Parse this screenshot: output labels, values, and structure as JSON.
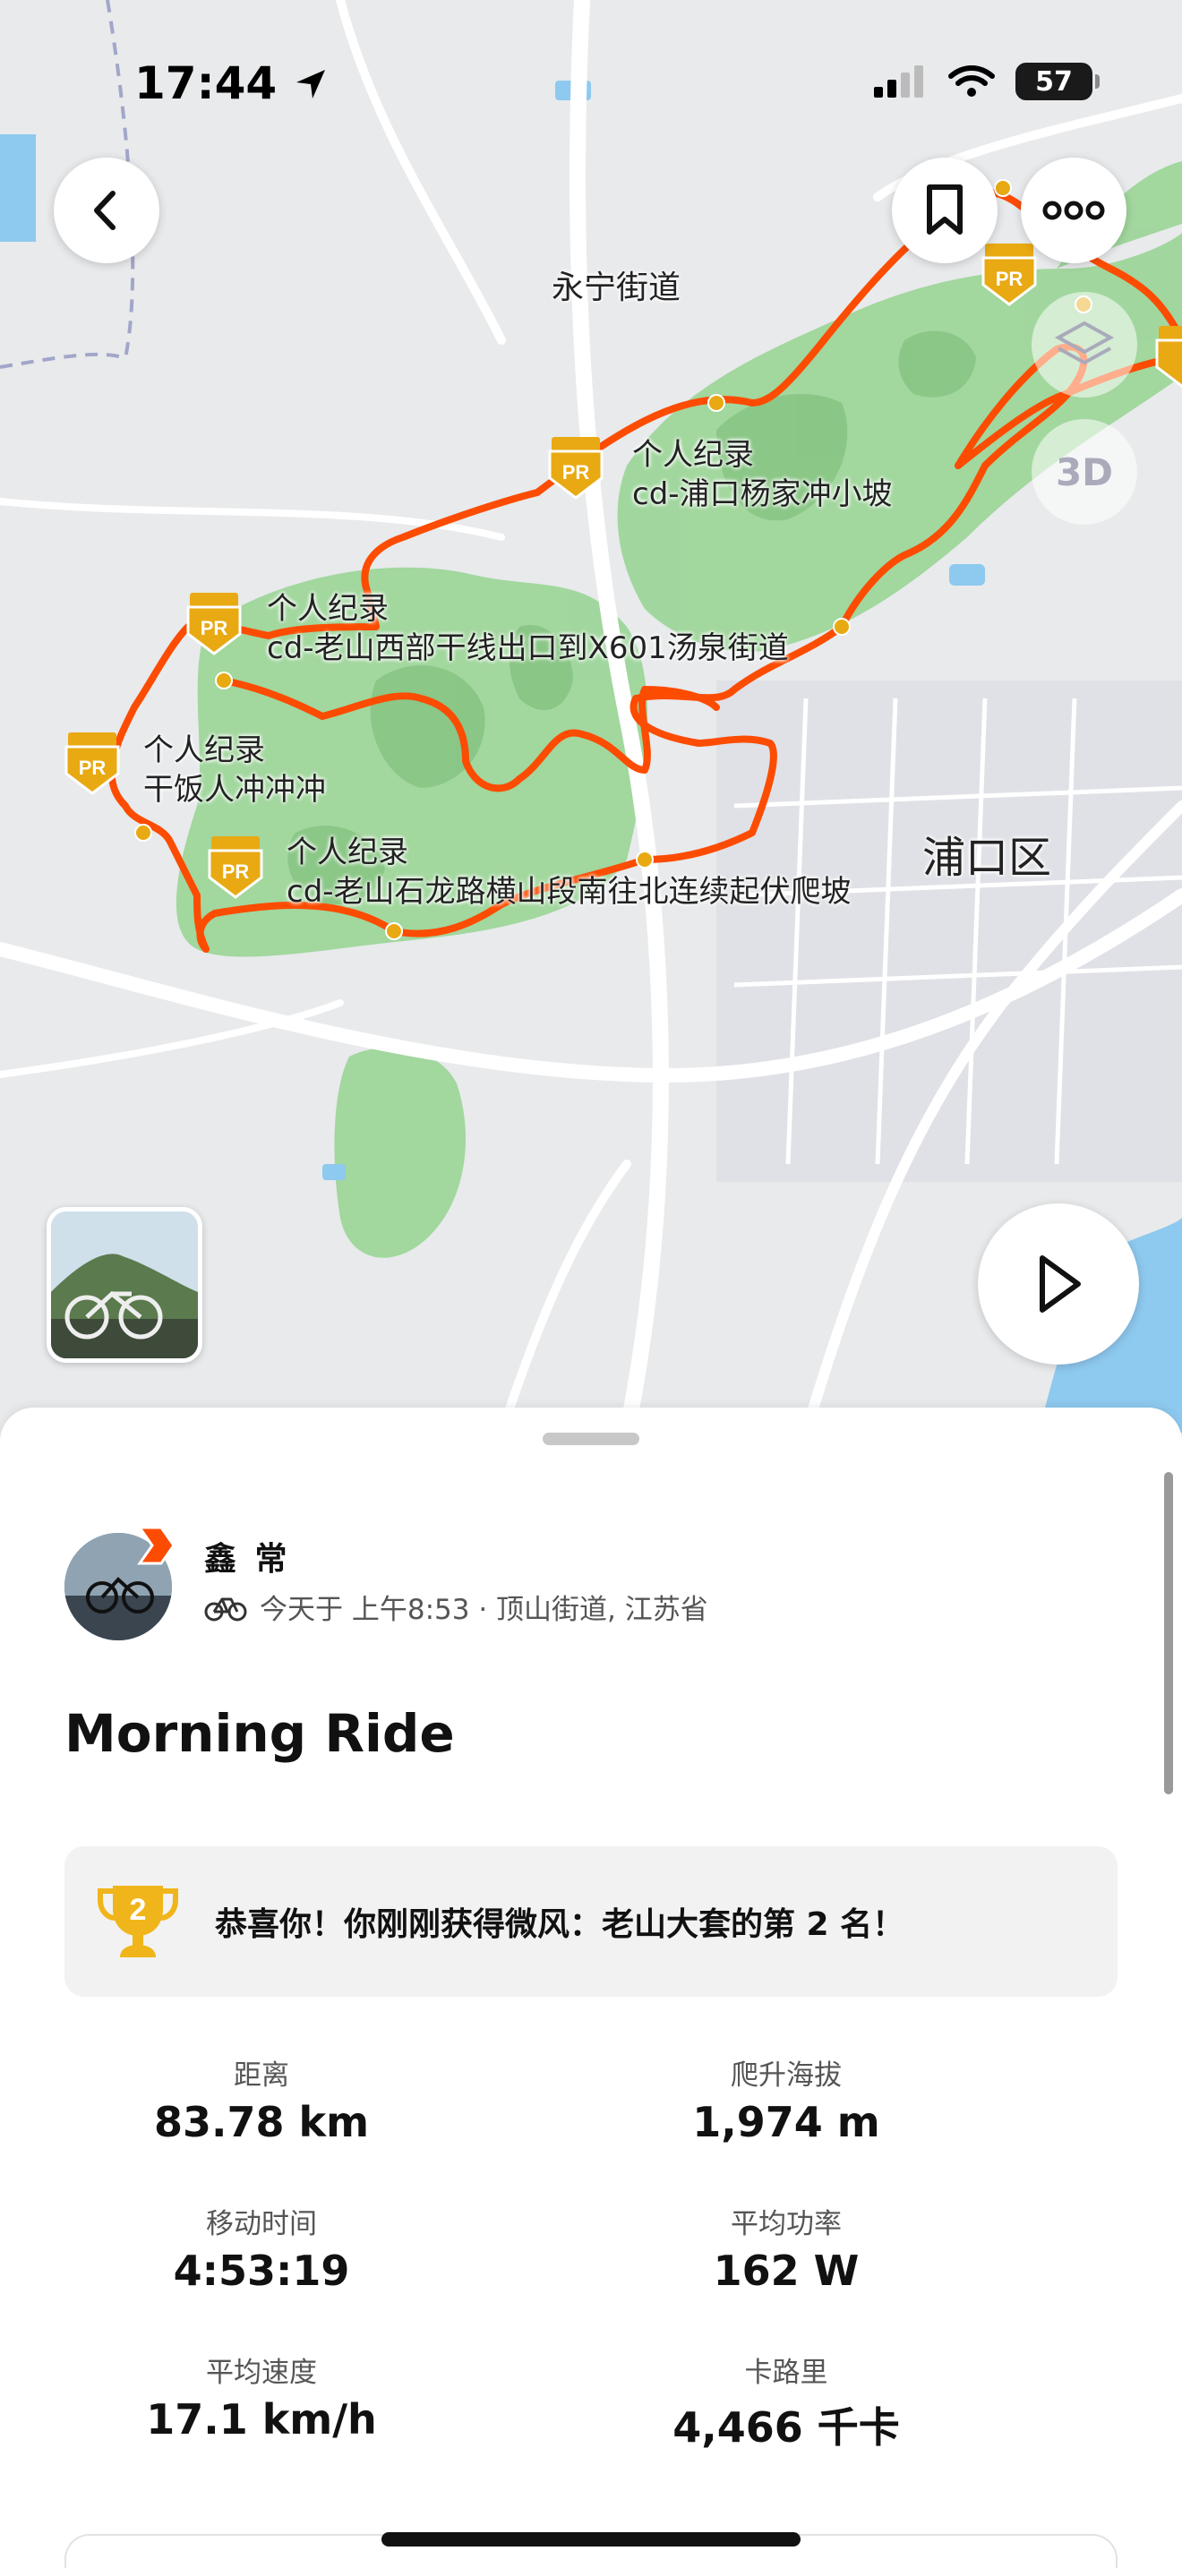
{
  "status_bar": {
    "time": "17:44",
    "battery": "57"
  },
  "map": {
    "labels": {
      "yongning": "永宁街道",
      "pukou": "浦口区"
    },
    "pr_segments": [
      {
        "tag": "个人纪录",
        "name": "cd-浦口杨家冲小坡"
      },
      {
        "tag": "个人纪录",
        "name": "cd-老山西部干线出口到X601汤泉街道"
      },
      {
        "tag": "个人纪录",
        "name": "干饭人冲冲冲"
      },
      {
        "tag": "个人纪录",
        "name": "cd-老山石龙路横山段南往北连续起伏爬坡"
      }
    ],
    "pr_badge_text": "PR",
    "button_3d": "3D"
  },
  "activity": {
    "athlete_name": "鑫 常",
    "meta": "今天于 上午8:53 · 顶山街道, 江苏省",
    "title": "Morning Ride",
    "achievement": {
      "rank_number": "2",
      "text": "恭喜你！你刚刚获得微风：老山大套的第 2 名！"
    },
    "stats": [
      {
        "label": "距离",
        "value": "83.78 km"
      },
      {
        "label": "爬升海拔",
        "value": "1,974 m"
      },
      {
        "label": "移动时间",
        "value": "4:53:19"
      },
      {
        "label": "平均功率",
        "value": "162 W"
      },
      {
        "label": "平均速度",
        "value": "17.1 km/h"
      },
      {
        "label": "卡路里",
        "value": "4,466 千卡"
      }
    ]
  },
  "colors": {
    "route": "#fc4c02",
    "park": "#8fd08a",
    "water": "#8ec9ef",
    "pr_gold": "#e8a912",
    "road": "#ffffff"
  }
}
